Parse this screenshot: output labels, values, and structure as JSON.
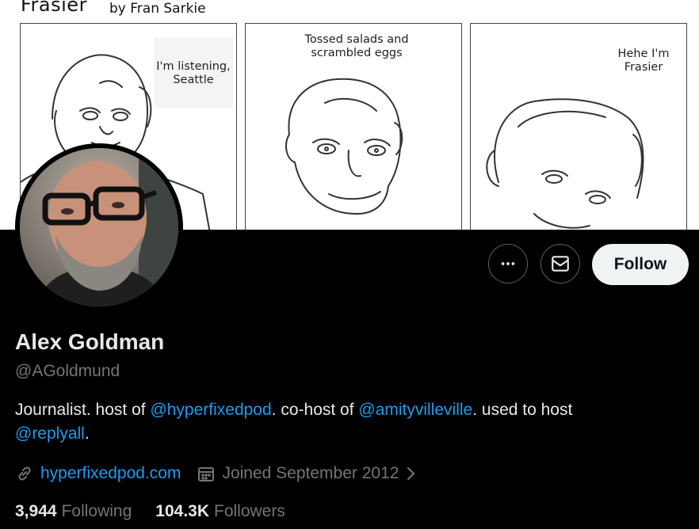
{
  "banner": {
    "comic_title": "Frasier",
    "comic_author": "by Fran Sarkie",
    "panels": [
      {
        "lines": [
          "I'm listening,",
          "Seattle"
        ]
      },
      {
        "lines": [
          "Tossed salads and",
          "scrambled eggs"
        ]
      },
      {
        "lines": [
          "Hehe I'm",
          "Frasier"
        ]
      }
    ]
  },
  "actions": {
    "more_icon": "more-horizontal-icon",
    "message_icon": "envelope-icon",
    "follow_label": "Follow"
  },
  "profile": {
    "name": "Alex Goldman",
    "handle": "@AGoldmund",
    "bio": {
      "t1": "Journalist. host of ",
      "m1": "@hyperfixedpod",
      "t2": ". co-host of ",
      "m2": "@amityvilleville",
      "t3": ". used to host ",
      "m3": "@replyall",
      "t4": "."
    },
    "website": "hyperfixedpod.com",
    "joined": "Joined September 2012",
    "following_count": "3,944",
    "following_label": "Following",
    "followers_count": "104.3K",
    "followers_label": "Followers"
  },
  "colors": {
    "background": "#000000",
    "accent": "#1d9bf0",
    "secondary_text": "#71767b",
    "primary_text": "#e7e9ea",
    "follow_button_bg": "#eff3f4"
  }
}
